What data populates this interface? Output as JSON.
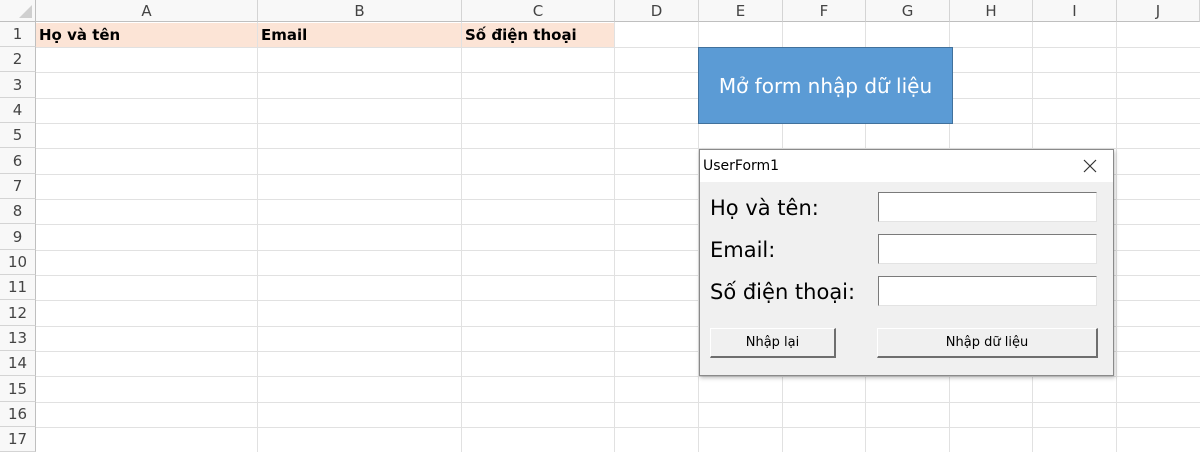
{
  "sheet": {
    "columns": [
      "A",
      "B",
      "C",
      "D",
      "E",
      "F",
      "G",
      "H",
      "I",
      "J"
    ],
    "rows": [
      "1",
      "2",
      "3",
      "4",
      "5",
      "6",
      "7",
      "8",
      "9",
      "10",
      "11",
      "12",
      "13",
      "14",
      "15",
      "16",
      "17"
    ],
    "row1_cells": [
      "Họ và tên",
      "Email",
      "Số điện thoại"
    ],
    "header_fill": "#fce4d6"
  },
  "macro_button": {
    "label": "Mở form nhập dữ liệu",
    "color": "#5b9bd5"
  },
  "userform": {
    "title": "UserForm1",
    "close_icon": "close-icon",
    "fields": [
      {
        "label": "Họ và tên:",
        "value": ""
      },
      {
        "label": "Email:",
        "value": ""
      },
      {
        "label": "Số điện thoại:",
        "value": ""
      }
    ],
    "buttons": {
      "reset": "Nhập lại",
      "submit": "Nhập dữ liệu"
    }
  }
}
